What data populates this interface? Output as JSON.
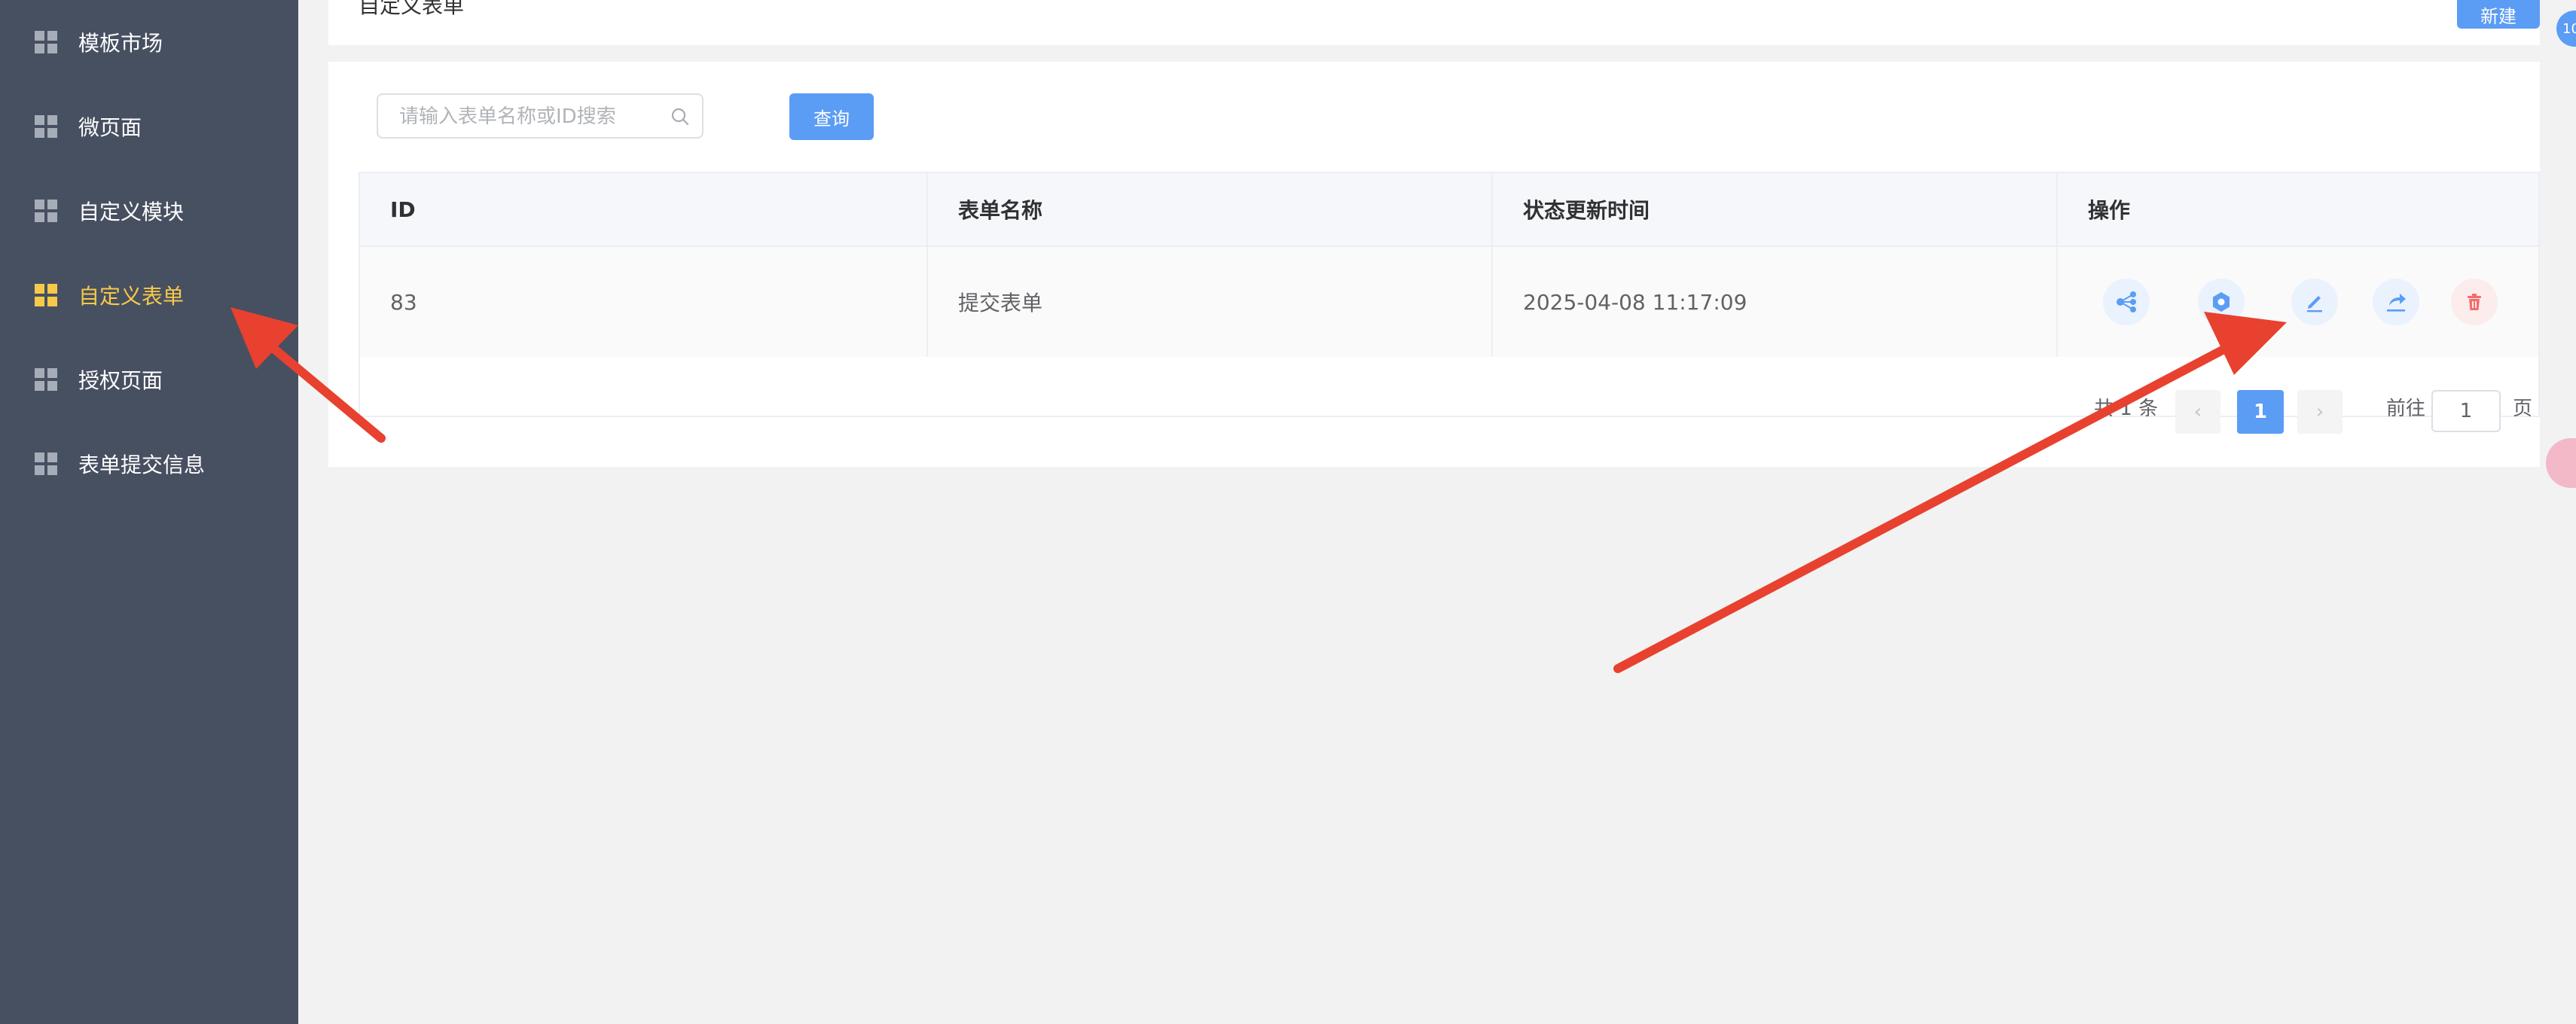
{
  "sidebar": {
    "items": [
      {
        "label": "模板市场",
        "active": false
      },
      {
        "label": "微页面",
        "active": false
      },
      {
        "label": "自定义模块",
        "active": false
      },
      {
        "label": "自定义表单",
        "active": true
      },
      {
        "label": "授权页面",
        "active": false
      },
      {
        "label": "表单提交信息",
        "active": false
      }
    ],
    "active_color": "#f7c948",
    "background": "#475061"
  },
  "header": {
    "title": "自定义表单",
    "new_button": "新建"
  },
  "floating": {
    "badge_text": "10"
  },
  "search": {
    "placeholder": "请输入表单名称或ID搜索",
    "value": "",
    "query_button": "查询"
  },
  "table": {
    "columns": [
      "ID",
      "表单名称",
      "状态更新时间",
      "操作"
    ],
    "rows": [
      {
        "id": "83",
        "name": "提交表单",
        "updated": "2025-04-08 11:17:09"
      }
    ],
    "actions": [
      {
        "icon": "flow-icon",
        "color": "#5b9cf5"
      },
      {
        "icon": "settings-hex-icon",
        "color": "#5b9cf5"
      },
      {
        "icon": "edit-icon",
        "color": "#5b9cf5"
      },
      {
        "icon": "share-icon",
        "color": "#5b9cf5"
      },
      {
        "icon": "delete-icon",
        "color": "#f56c6c"
      }
    ]
  },
  "pagination": {
    "total_text": "共 1 条",
    "prev": "‹",
    "current": "1",
    "next": "›",
    "goto_label": "前往",
    "goto_value": "1",
    "page_suffix": "页"
  },
  "colors": {
    "primary": "#5b9cf5",
    "danger": "#f56c6c",
    "annotation": "#e8412f"
  }
}
